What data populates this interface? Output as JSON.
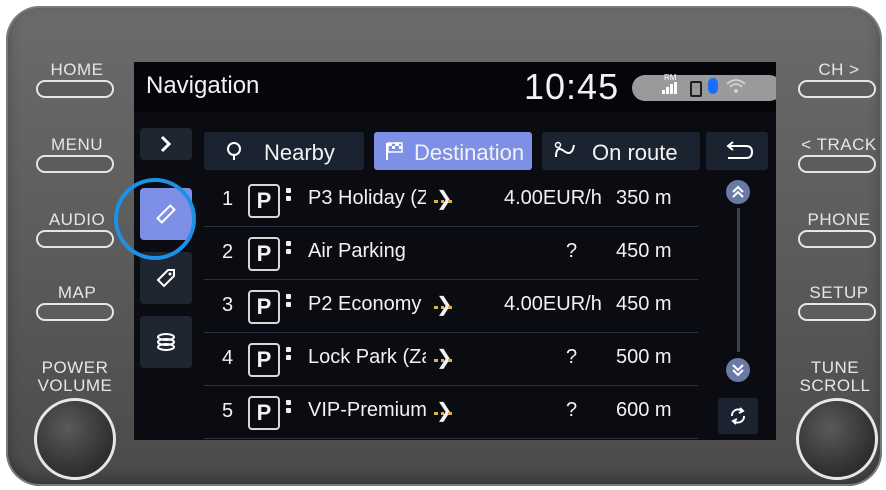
{
  "hardware": {
    "left": [
      {
        "label": "HOME"
      },
      {
        "label": "MENU"
      },
      {
        "label": "AUDIO"
      },
      {
        "label": "MAP"
      }
    ],
    "right": [
      {
        "label": "CH >"
      },
      {
        "label": "< TRACK"
      },
      {
        "label": "PHONE"
      },
      {
        "label": "SETUP"
      }
    ],
    "power_label_1": "POWER",
    "power_label_2": "VOLUME",
    "tune_label_1": "TUNE",
    "tune_label_2": "SCROLL"
  },
  "header": {
    "title": "Navigation",
    "clock": "10:45",
    "rm_label": "RM"
  },
  "tabs": [
    {
      "label": "Nearby"
    },
    {
      "label": "Destination"
    },
    {
      "label": "On route"
    }
  ],
  "list": [
    {
      "num": "1",
      "name": "P3 Holiday (Za",
      "price": "4.00EUR/h",
      "distance": "350 m"
    },
    {
      "num": "2",
      "name": "Air Parking",
      "price": "?",
      "distance": "450 m"
    },
    {
      "num": "3",
      "name": "P2 Economy (Z",
      "price": "4.00EUR/h",
      "distance": "450 m"
    },
    {
      "num": "4",
      "name": "Lock Park (Zav",
      "price": "?",
      "distance": "500 m"
    },
    {
      "num": "5",
      "name": "VIP-Premium",
      "price": "?",
      "distance": "600 m"
    }
  ],
  "icons": {
    "parking_glyph": "P"
  },
  "colors": {
    "active_tab": "#7e8fe6",
    "highlight_ring": "#1e90e6",
    "bluetooth": "#1a6dff"
  }
}
